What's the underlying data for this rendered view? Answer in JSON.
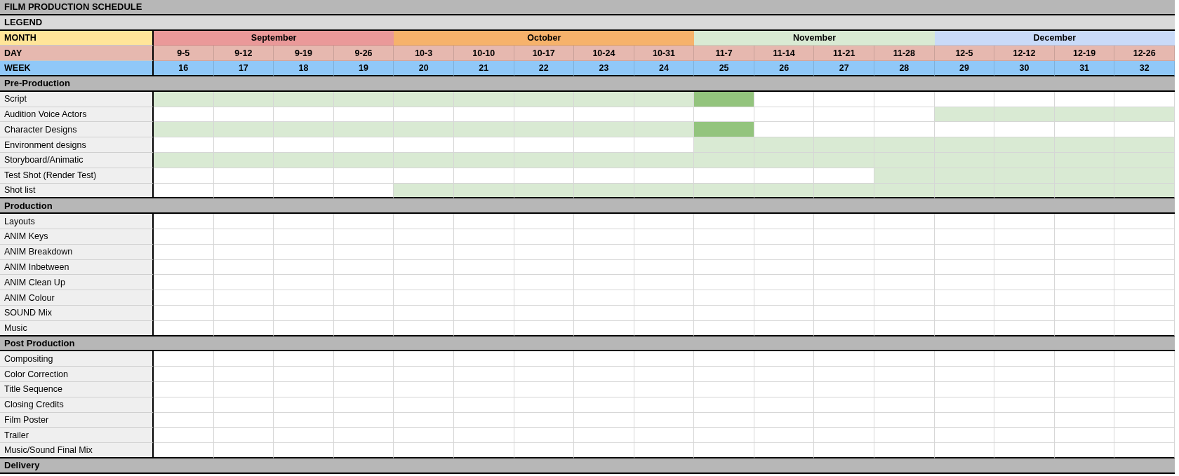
{
  "title": "FILM PRODUCTION SCHEDULE",
  "legend": "LEGEND",
  "labels": {
    "month": "MONTH",
    "day": "DAY",
    "week": "WEEK"
  },
  "months": [
    {
      "name": "September",
      "color": "#ea9999",
      "days": [
        {
          "day": "9-5",
          "week": "16"
        },
        {
          "day": "9-12",
          "week": "17"
        },
        {
          "day": "9-19",
          "week": "18"
        },
        {
          "day": "9-26",
          "week": "19"
        }
      ]
    },
    {
      "name": "October",
      "color": "#f6b26b",
      "days": [
        {
          "day": "10-3",
          "week": "20"
        },
        {
          "day": "10-10",
          "week": "21"
        },
        {
          "day": "10-17",
          "week": "22"
        },
        {
          "day": "10-24",
          "week": "23"
        },
        {
          "day": "10-31",
          "week": "24"
        }
      ]
    },
    {
      "name": "November",
      "color": "#d9ead3",
      "days": [
        {
          "day": "11-7",
          "week": "25"
        },
        {
          "day": "11-14",
          "week": "26"
        },
        {
          "day": "11-21",
          "week": "27"
        },
        {
          "day": "11-28",
          "week": "28"
        }
      ]
    },
    {
      "name": "December",
      "color": "#c9daf8",
      "days": [
        {
          "day": "12-5",
          "week": "29"
        },
        {
          "day": "12-12",
          "week": "30"
        },
        {
          "day": "12-19",
          "week": "31"
        },
        {
          "day": "12-26",
          "week": "32"
        }
      ]
    }
  ],
  "sections": [
    {
      "title": "Pre-Production",
      "tasks": [
        {
          "name": "Script",
          "cells": [
            {
              "kind": "plan"
            },
            {
              "kind": "plan"
            },
            {
              "kind": "plan"
            },
            {
              "kind": "plan"
            },
            {
              "kind": "plan"
            },
            {
              "kind": "plan"
            },
            {
              "kind": "plan"
            },
            {
              "kind": "plan"
            },
            {
              "kind": "plan"
            },
            {
              "kind": "done"
            },
            {
              "kind": "empty"
            },
            {
              "kind": "empty"
            },
            {
              "kind": "empty"
            },
            {
              "kind": "empty"
            },
            {
              "kind": "empty"
            },
            {
              "kind": "empty"
            },
            {
              "kind": "empty"
            }
          ]
        },
        {
          "name": "Audition Voice Actors",
          "cells": [
            {
              "kind": "empty"
            },
            {
              "kind": "empty"
            },
            {
              "kind": "empty"
            },
            {
              "kind": "empty"
            },
            {
              "kind": "empty"
            },
            {
              "kind": "empty"
            },
            {
              "kind": "empty"
            },
            {
              "kind": "empty"
            },
            {
              "kind": "empty"
            },
            {
              "kind": "empty"
            },
            {
              "kind": "empty"
            },
            {
              "kind": "empty"
            },
            {
              "kind": "empty"
            },
            {
              "kind": "plan"
            },
            {
              "kind": "plan"
            },
            {
              "kind": "plan"
            },
            {
              "kind": "plan"
            }
          ]
        },
        {
          "name": "Character Designs",
          "cells": [
            {
              "kind": "plan"
            },
            {
              "kind": "plan"
            },
            {
              "kind": "plan"
            },
            {
              "kind": "plan"
            },
            {
              "kind": "plan"
            },
            {
              "kind": "plan"
            },
            {
              "kind": "plan"
            },
            {
              "kind": "plan"
            },
            {
              "kind": "plan"
            },
            {
              "kind": "done"
            },
            {
              "kind": "empty"
            },
            {
              "kind": "empty"
            },
            {
              "kind": "empty"
            },
            {
              "kind": "empty"
            },
            {
              "kind": "empty"
            },
            {
              "kind": "empty"
            },
            {
              "kind": "empty"
            }
          ]
        },
        {
          "name": "Environment designs",
          "cells": [
            {
              "kind": "empty"
            },
            {
              "kind": "empty"
            },
            {
              "kind": "empty"
            },
            {
              "kind": "empty"
            },
            {
              "kind": "empty"
            },
            {
              "kind": "empty"
            },
            {
              "kind": "empty"
            },
            {
              "kind": "empty"
            },
            {
              "kind": "empty"
            },
            {
              "kind": "plan"
            },
            {
              "kind": "plan"
            },
            {
              "kind": "plan"
            },
            {
              "kind": "plan"
            },
            {
              "kind": "plan"
            },
            {
              "kind": "plan"
            },
            {
              "kind": "plan"
            },
            {
              "kind": "plan"
            }
          ]
        },
        {
          "name": "Storyboard/Animatic",
          "cells": [
            {
              "kind": "plan"
            },
            {
              "kind": "plan"
            },
            {
              "kind": "plan"
            },
            {
              "kind": "plan"
            },
            {
              "kind": "plan"
            },
            {
              "kind": "plan"
            },
            {
              "kind": "plan"
            },
            {
              "kind": "plan"
            },
            {
              "kind": "plan"
            },
            {
              "kind": "plan"
            },
            {
              "kind": "plan"
            },
            {
              "kind": "plan"
            },
            {
              "kind": "plan"
            },
            {
              "kind": "plan"
            },
            {
              "kind": "plan"
            },
            {
              "kind": "plan"
            },
            {
              "kind": "plan"
            }
          ]
        },
        {
          "name": "Test Shot (Render Test)",
          "cells": [
            {
              "kind": "empty"
            },
            {
              "kind": "empty"
            },
            {
              "kind": "empty"
            },
            {
              "kind": "empty"
            },
            {
              "kind": "empty"
            },
            {
              "kind": "empty"
            },
            {
              "kind": "empty"
            },
            {
              "kind": "empty"
            },
            {
              "kind": "empty"
            },
            {
              "kind": "empty"
            },
            {
              "kind": "empty"
            },
            {
              "kind": "empty"
            },
            {
              "kind": "plan"
            },
            {
              "kind": "plan"
            },
            {
              "kind": "plan"
            },
            {
              "kind": "plan"
            },
            {
              "kind": "plan"
            }
          ]
        },
        {
          "name": "Shot list",
          "cells": [
            {
              "kind": "empty"
            },
            {
              "kind": "empty"
            },
            {
              "kind": "empty"
            },
            {
              "kind": "empty"
            },
            {
              "kind": "plan"
            },
            {
              "kind": "plan"
            },
            {
              "kind": "plan"
            },
            {
              "kind": "plan"
            },
            {
              "kind": "plan"
            },
            {
              "kind": "plan"
            },
            {
              "kind": "plan"
            },
            {
              "kind": "plan"
            },
            {
              "kind": "plan"
            },
            {
              "kind": "plan"
            },
            {
              "kind": "plan"
            },
            {
              "kind": "plan"
            },
            {
              "kind": "plan"
            }
          ]
        }
      ]
    },
    {
      "title": "Production",
      "tasks": [
        {
          "name": "Layouts"
        },
        {
          "name": "ANIM Keys"
        },
        {
          "name": "ANIM Breakdown"
        },
        {
          "name": "ANIM Inbetween"
        },
        {
          "name": "ANIM Clean Up"
        },
        {
          "name": "ANIM Colour"
        },
        {
          "name": "SOUND Mix"
        },
        {
          "name": "Music"
        }
      ]
    },
    {
      "title": "Post Production",
      "tasks": [
        {
          "name": "Compositing"
        },
        {
          "name": "Color Correction"
        },
        {
          "name": "Title Sequence"
        },
        {
          "name": "Closing Credits"
        },
        {
          "name": "Film Poster"
        },
        {
          "name": "Trailer"
        },
        {
          "name": "Music/Sound Final Mix"
        }
      ]
    },
    {
      "title": "Delivery"
    }
  ]
}
